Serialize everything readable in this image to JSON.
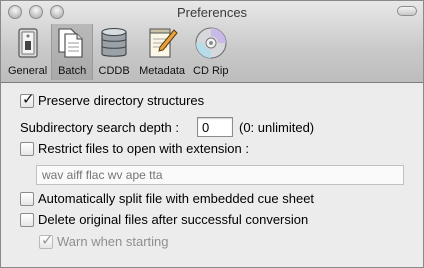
{
  "window": {
    "title": "Preferences"
  },
  "toolbar": {
    "items": [
      {
        "label": "General",
        "icon": "switch-icon"
      },
      {
        "label": "Batch",
        "icon": "documents-icon",
        "selected": true
      },
      {
        "label": "CDDB",
        "icon": "database-icon"
      },
      {
        "label": "Metadata",
        "icon": "notepad-pencil-icon"
      },
      {
        "label": "CD Rip",
        "icon": "cd-icon"
      }
    ]
  },
  "options": {
    "preserve_dirs": {
      "label": "Preserve directory structures",
      "checked": true
    },
    "depth": {
      "label": "Subdirectory search depth :",
      "value": "0",
      "hint": "(0: unlimited)"
    },
    "restrict_ext": {
      "label": "Restrict files to open with extension :",
      "checked": false,
      "placeholder": "wav aiff flac wv ape tta"
    },
    "split_cue": {
      "label": "Automatically split file with embedded cue sheet",
      "checked": false
    },
    "delete_original": {
      "label": "Delete original files after successful conversion",
      "checked": false
    },
    "warn_start": {
      "label": "Warn when starting",
      "checked": true,
      "disabled": true
    }
  }
}
